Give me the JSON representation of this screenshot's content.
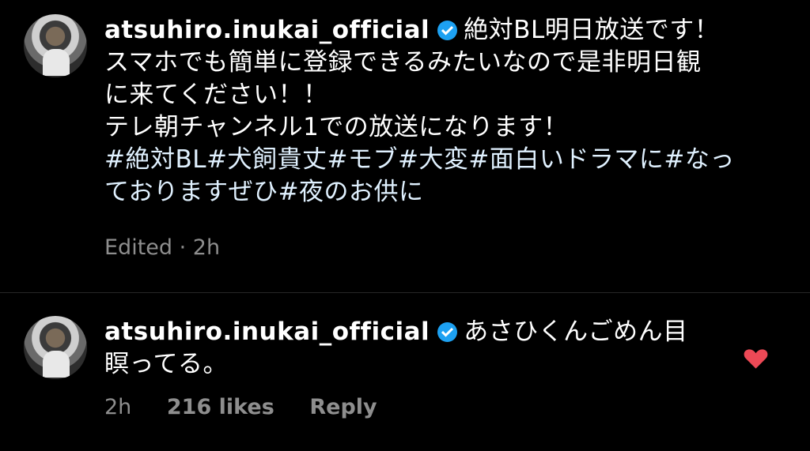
{
  "caption": {
    "username": "atsuhiro.inukai_official",
    "lines": [
      "絶対BL明日放送です！",
      "スマホでも簡単に登録できるみたいなので是非明日観",
      "に来てください！！",
      "テレ朝チャンネル1での放送になります！",
      "#絶対BL#犬飼貴丈#モブ#大変#面白いドラマに#なっ",
      "ておりますぜひ#夜のお供に"
    ],
    "meta": "Edited · 2h"
  },
  "comment": {
    "username": "atsuhiro.inukai_official",
    "lines": [
      "あさひくんごめん目",
      "瞑ってる。"
    ],
    "time": "2h",
    "likes": "216 likes",
    "reply": "Reply"
  },
  "colors": {
    "verified": "#1da1f2",
    "heart": "#ed4956",
    "muted": "#8e8e8e"
  },
  "icons": [
    "verified-badge-icon",
    "heart-icon"
  ]
}
